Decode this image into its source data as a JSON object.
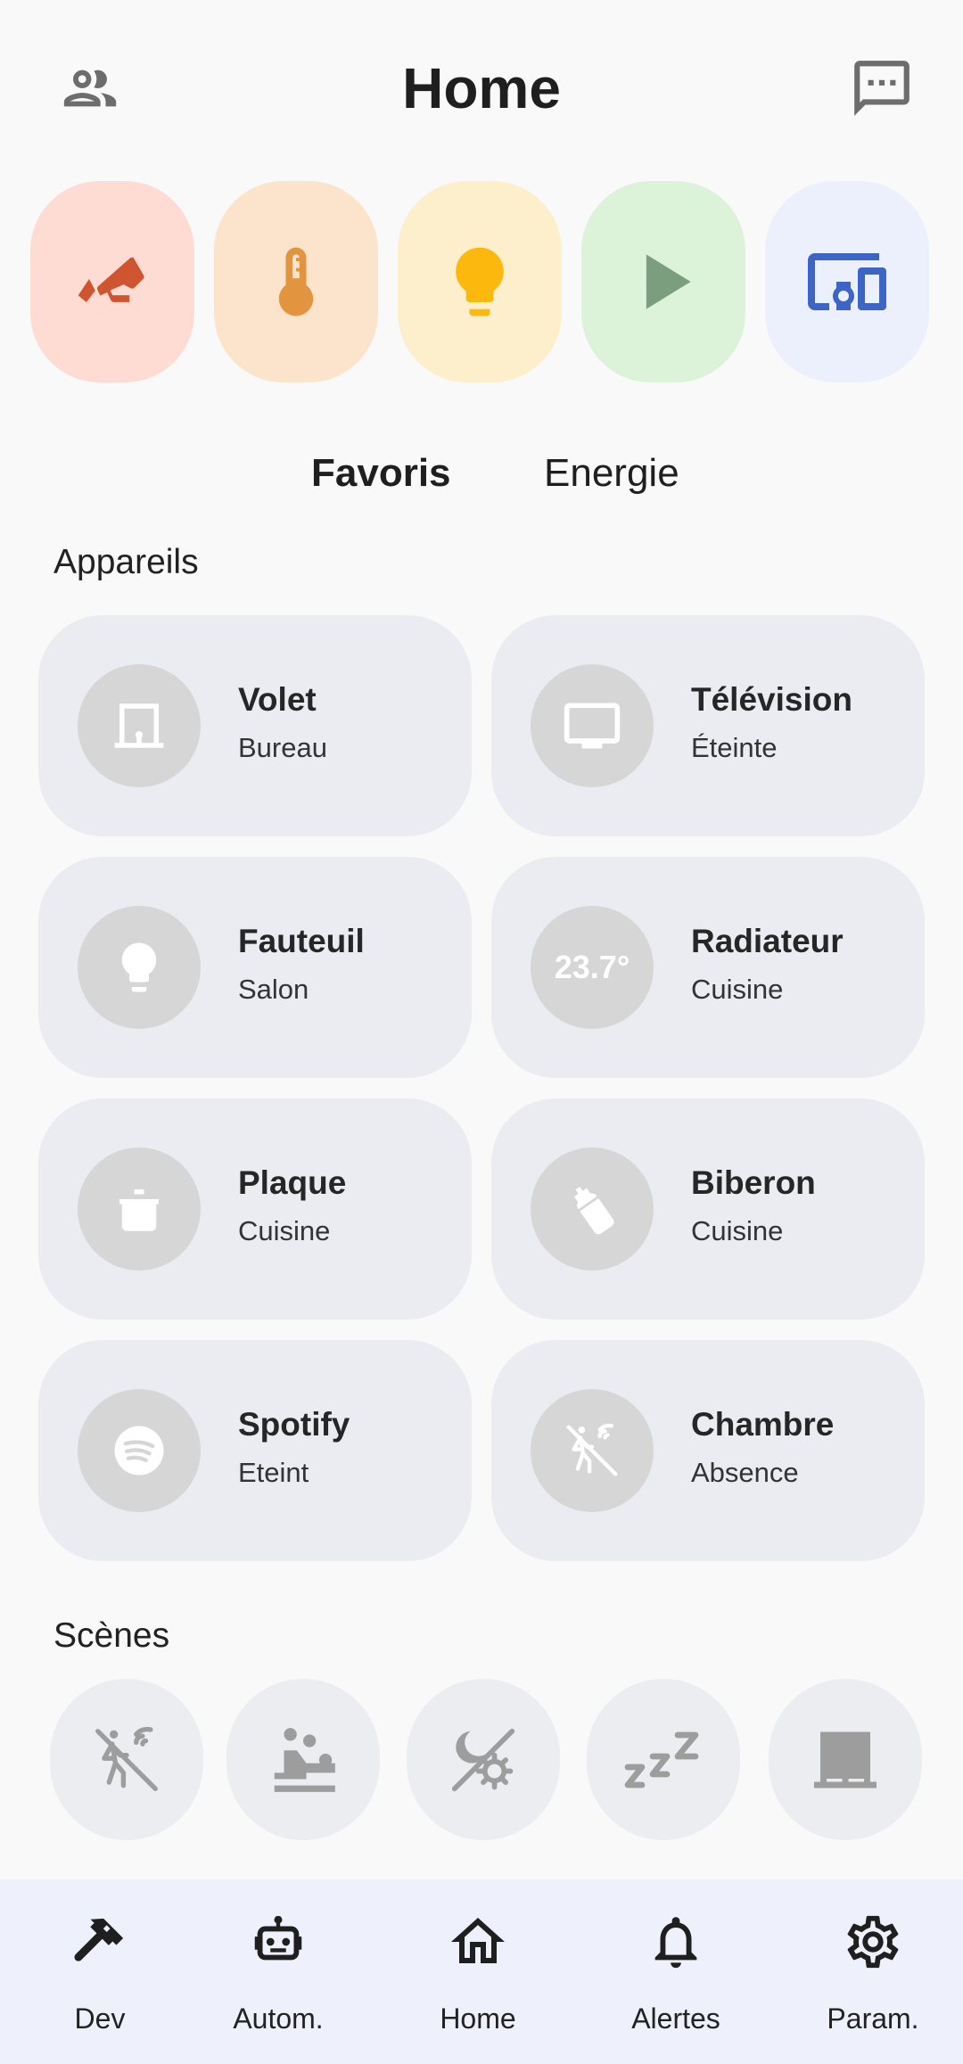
{
  "header": {
    "title": "Home",
    "left_icon": "people-icon",
    "right_icon": "message-icon"
  },
  "categories": [
    {
      "icon": "cctv-icon",
      "bg": "#fedcd3",
      "color": "#cf5530"
    },
    {
      "icon": "thermometer-icon",
      "bg": "#fbe3cc",
      "color": "#e3943f"
    },
    {
      "icon": "lightbulb-icon",
      "bg": "#fdefcc",
      "color": "#fdb80e"
    },
    {
      "icon": "play-icon",
      "bg": "#dcf3da",
      "color": "#7a9e7e"
    },
    {
      "icon": "devices-icon",
      "bg": "#ecf0fd",
      "color": "#3d65c5"
    }
  ],
  "tabs": [
    {
      "label": "Favoris",
      "active": true
    },
    {
      "label": "Energie",
      "active": false
    }
  ],
  "sections": {
    "devices": "Appareils",
    "scenes": "Scènes"
  },
  "devices": [
    {
      "name": "Volet",
      "state": "Bureau",
      "icon": "shutter-icon"
    },
    {
      "name": "Télévision",
      "state": "Éteinte",
      "icon": "tv-icon"
    },
    {
      "name": "Fauteuil",
      "state": "Salon",
      "icon": "lightbulb-icon"
    },
    {
      "name": "Radiateur",
      "state": "Cuisine",
      "icon": "temperature-badge",
      "value": "23.7°"
    },
    {
      "name": "Plaque",
      "state": "Cuisine",
      "icon": "pot-icon"
    },
    {
      "name": "Biberon",
      "state": "Cuisine",
      "icon": "baby-bottle-icon"
    },
    {
      "name": "Spotify",
      "state": "Eteint",
      "icon": "spotify-icon"
    },
    {
      "name": "Chambre",
      "state": "Absence",
      "icon": "motion-sensor-off-icon"
    }
  ],
  "scenes": [
    {
      "icon": "motion-sensor-off-icon"
    },
    {
      "icon": "baby-changing-icon"
    },
    {
      "icon": "day-night-icon"
    },
    {
      "icon": "sleep-icon"
    },
    {
      "icon": "shutter-icon"
    }
  ],
  "nav": [
    {
      "label": "Dev",
      "icon": "hammer-icon"
    },
    {
      "label": "Autom.",
      "icon": "robot-icon"
    },
    {
      "label": "Home",
      "icon": "home-icon"
    },
    {
      "label": "Alertes",
      "icon": "bell-icon"
    },
    {
      "label": "Param.",
      "icon": "gear-icon"
    }
  ]
}
